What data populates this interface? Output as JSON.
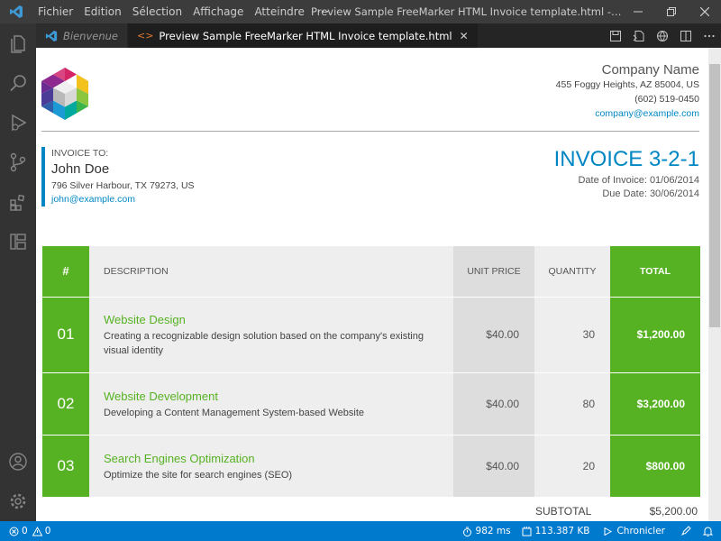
{
  "titlebar": {
    "menu": [
      "Fichier",
      "Edition",
      "Sélection",
      "Affichage",
      "Atteindre"
    ],
    "more": "···",
    "window_title": "Preview Sample FreeMarker HTML Invoice template.html - Hardis_XSL-..."
  },
  "tabs": [
    {
      "label": "Bienvenue",
      "active": false
    },
    {
      "label": "Preview Sample FreeMarker HTML Invoice template.html",
      "active": true
    }
  ],
  "company": {
    "name": "Company Name",
    "address": "455 Foggy Heights, AZ 85004, US",
    "phone": "(602) 519-0450",
    "email": "company@example.com"
  },
  "client": {
    "label": "INVOICE TO:",
    "name": "John Doe",
    "address": "796 Silver Harbour, TX 79273, US",
    "email": "john@example.com"
  },
  "invoice": {
    "title": "INVOICE 3-2-1",
    "date": "Date of Invoice: 01/06/2014",
    "due": "Due Date: 30/06/2014"
  },
  "table": {
    "headers": {
      "no": "#",
      "desc": "DESCRIPTION",
      "unit": "UNIT PRICE",
      "qty": "QUANTITY",
      "total": "TOTAL"
    },
    "rows": [
      {
        "no": "01",
        "title": "Website Design",
        "desc": "Creating a recognizable design solution based on the company's existing visual identity",
        "unit": "$40.00",
        "qty": "30",
        "total": "$1,200.00"
      },
      {
        "no": "02",
        "title": "Website Development",
        "desc": "Developing a Content Management System-based Website",
        "unit": "$40.00",
        "qty": "80",
        "total": "$3,200.00"
      },
      {
        "no": "03",
        "title": "Search Engines Optimization",
        "desc": "Optimize the site for search engines (SEO)",
        "unit": "$40.00",
        "qty": "20",
        "total": "$800.00"
      }
    ],
    "subtotal_label": "SUBTOTAL",
    "subtotal_value": "$5,200.00"
  },
  "statusbar": {
    "errors": "0",
    "warnings": "0",
    "time": "982 ms",
    "memory": "113.387 KB",
    "chronicler": "Chronicler"
  },
  "colors": {
    "accent_green": "#57b223",
    "accent_blue": "#0087c3",
    "status_blue": "#007acc"
  }
}
